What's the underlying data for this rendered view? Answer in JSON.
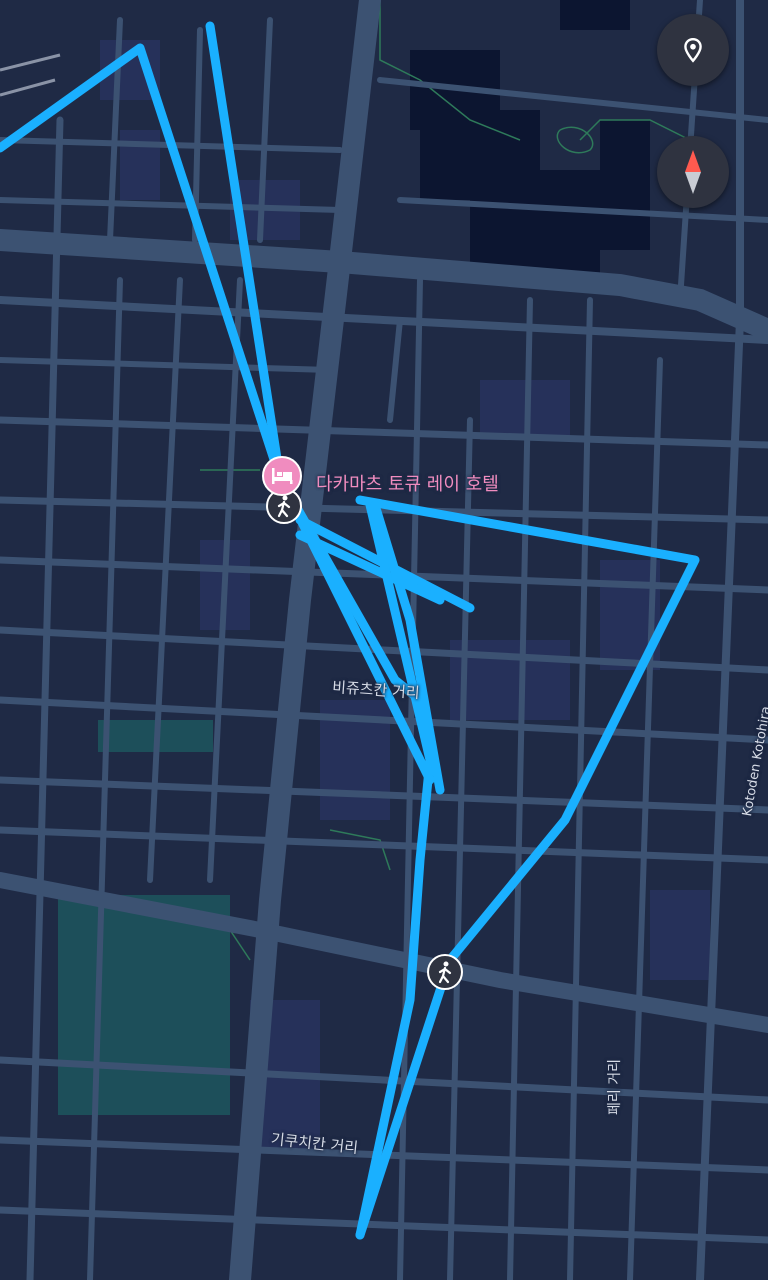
{
  "poi": {
    "name": "다카마츠 토큐 레이 호텔",
    "icon": "hotel-bed-icon",
    "color": "#f08cbf"
  },
  "streets": {
    "vizucchikan": "비쥬츠칸 거리",
    "kikuchikan": "기쿠치칸 거리",
    "peri": "페리 거리",
    "kotoden": "Kotoden Kotohira"
  },
  "controls": {
    "location_icon": "location-pin-icon",
    "compass_icon": "compass-icon"
  },
  "markers": {
    "pedestrian_icon": "pedestrian-icon"
  },
  "colors": {
    "background": "#1f2a45",
    "route": "#1ab0ff",
    "road": "#3c5272",
    "park": "#1d4f5a",
    "building_dark": "#0c1530"
  }
}
